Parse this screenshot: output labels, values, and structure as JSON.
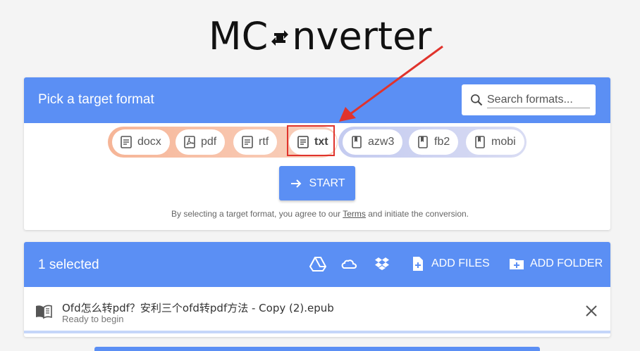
{
  "logo": {
    "prefix": "MC",
    "suffix": "nverter"
  },
  "picker": {
    "title": "Pick a target format",
    "search_placeholder": "Search formats...",
    "formats_document": [
      {
        "label": "docx",
        "icon": "document-icon"
      },
      {
        "label": "pdf",
        "icon": "pdf-icon"
      },
      {
        "label": "rtf",
        "icon": "document-icon"
      },
      {
        "label": "txt",
        "icon": "document-icon",
        "selected": true
      }
    ],
    "formats_ebook": [
      {
        "label": "azw3",
        "icon": "book-icon"
      },
      {
        "label": "fb2",
        "icon": "book-icon"
      },
      {
        "label": "mobi",
        "icon": "book-icon"
      }
    ],
    "start_label": "START",
    "legal_prefix": "By selecting a target format, you agree to our ",
    "legal_link": "Terms",
    "legal_suffix": " and initiate the conversion."
  },
  "files": {
    "selected_count": "1 selected",
    "sources": [
      "google-drive-icon",
      "onedrive-icon",
      "dropbox-icon"
    ],
    "add_files_label": "ADD FILES",
    "add_folder_label": "ADD FOLDER",
    "items": [
      {
        "name": "Ofd怎么转pdf？安利三个ofd转pdf方法 - Copy (2).epub",
        "status": "Ready to begin"
      }
    ]
  },
  "colors": {
    "accent": "#5b8ff4",
    "highlight": "#e0332c"
  }
}
